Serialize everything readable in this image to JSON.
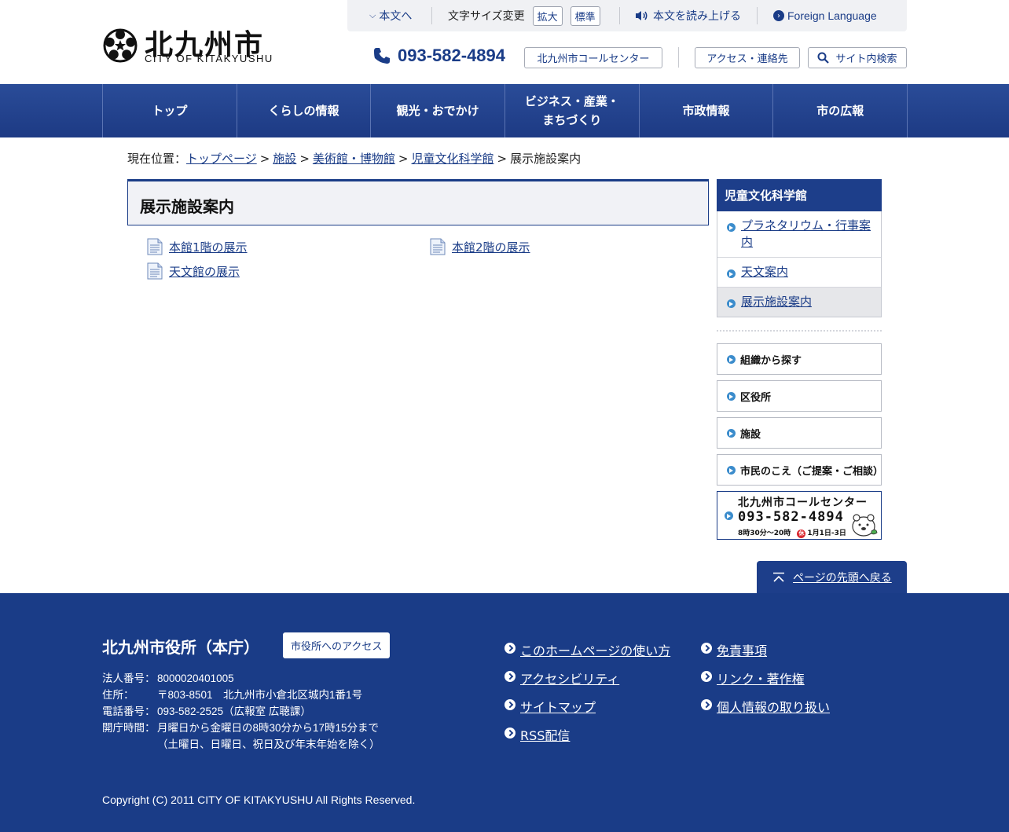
{
  "header": {
    "logo_jp": "北九州市",
    "logo_en": "CITY OF KITAKYUSHU",
    "skip_to_content": "本文へ",
    "font_size_label": "文字サイズ変更",
    "font_size_large": "拡大",
    "font_size_standard": "標準",
    "read_aloud": "本文を読み上げる",
    "foreign_language": "Foreign Language",
    "phone_number": "093-582-4894",
    "call_center": "北九州市コールセンター",
    "access_contact": "アクセス・連絡先",
    "site_search": "サイト内検索"
  },
  "nav": {
    "items": [
      {
        "label": "トップ"
      },
      {
        "label": "くらしの情報"
      },
      {
        "label": "観光・おでかけ"
      },
      {
        "label": "ビジネス・産業・\nまちづくり"
      },
      {
        "label": "市政情報"
      },
      {
        "label": "市の広報"
      }
    ]
  },
  "breadcrumb": {
    "prefix": "現在位置：",
    "items": [
      "トップページ",
      "施設",
      "美術館・博物館",
      "児童文化科学館"
    ],
    "separator": ">",
    "current": "展示施設案内"
  },
  "main": {
    "title": "展示施設案内",
    "links": [
      "本館1階の展示",
      "本館2階の展示",
      "天文館の展示"
    ]
  },
  "sidebar": {
    "heading": "児童文化科学館",
    "items": [
      {
        "label": "プラネタリウム・行事案内"
      },
      {
        "label": "天文案内"
      },
      {
        "label": "展示施設案内"
      }
    ],
    "banners": [
      "組織から探す",
      "区役所",
      "施設",
      "市民のこえ（ご提案・ご相談）"
    ],
    "call_center_banner": {
      "title": "北九州市コールセンター",
      "number": "093-582-4894",
      "hours": "8時30分～20時",
      "closed_mark": "休",
      "closed": "1月1日-3日"
    }
  },
  "back_to_top": "ページの先頭へ戻る",
  "footer": {
    "title": "北九州市役所（本庁）",
    "access_button": "市役所へのアクセス",
    "info": [
      {
        "key": "法人番号：",
        "value": "8000020401005"
      },
      {
        "key": "住所：",
        "value": "〒803-8501　北九州市小倉北区城内1番1号"
      },
      {
        "key": "電話番号：",
        "value": "093-582-2525（広報室 広聴課）"
      },
      {
        "key": "開庁時間：",
        "value": "月曜日から金曜日の8時30分から17時15分まで"
      },
      {
        "key": "",
        "value": "（土曜日、日曜日、祝日及び年末年始を除く）"
      }
    ],
    "links_col1": [
      "このホームページの使い方",
      "アクセシビリティ",
      "サイトマップ",
      "RSS配信"
    ],
    "links_col2": [
      "免責事項",
      "リンク・著作権",
      "個人情報の取り扱い"
    ],
    "copyright": "Copyright (C) 2011 CITY OF KITAKYUSHU All Rights Reserved."
  },
  "colors": {
    "primary": "#1a3c87",
    "accent_bullet": "#3b8ccc",
    "closed_red": "#d8262e"
  }
}
